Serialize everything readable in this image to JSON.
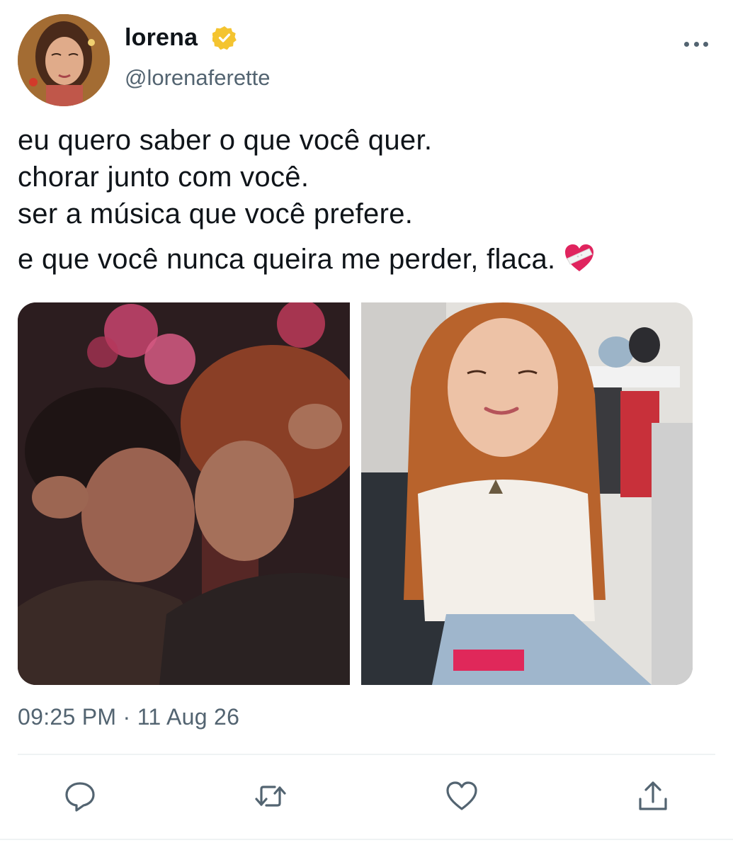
{
  "tweet": {
    "author": {
      "display_name": "lorena",
      "handle": "@lorenaferette",
      "verified": true,
      "verified_badge_color": "#f4c430"
    },
    "text_lines": [
      "eu quero saber o que você quer.",
      "chorar junto com você.",
      "ser a música que você prefere.",
      "e que você nunca queira me perder, flaca."
    ],
    "emoji": "mending-heart",
    "media": [
      {
        "icon": "photo-embrace"
      },
      {
        "icon": "photo-portrait"
      }
    ],
    "timestamp": "09:25 PM · 11 Aug 26"
  },
  "actions": [
    {
      "icon": "reply-icon"
    },
    {
      "icon": "retweet-icon"
    },
    {
      "icon": "like-icon"
    },
    {
      "icon": "share-icon"
    }
  ],
  "colors": {
    "text": "#0f1419",
    "secondary": "#536471",
    "divider": "#eff3f4",
    "heart": "#e0245e"
  }
}
